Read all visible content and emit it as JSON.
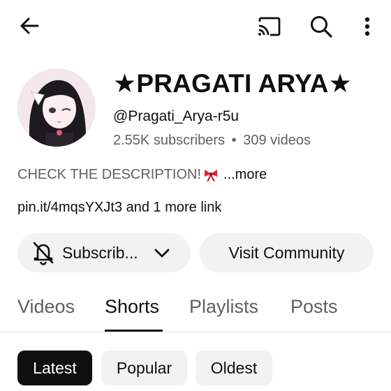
{
  "channel": {
    "name": "★PRAGATI ARYA★",
    "handle": "@Pragati_Arya-r5u",
    "subscribers": "2.55K subscribers",
    "separator": "•",
    "videos": "309 videos",
    "description": "CHECK THE DESCRIPTION!",
    "description_emoji": "ribbon-icon",
    "more": "...more",
    "links": "pin.it/4mqsYXJt3 and 1 more link"
  },
  "actions": {
    "subscribe_label": "Subscrib...",
    "community_label": "Visit Community"
  },
  "tabs": [
    {
      "label": "Videos",
      "active": false
    },
    {
      "label": "Shorts",
      "active": true
    },
    {
      "label": "Playlists",
      "active": false
    },
    {
      "label": "Posts",
      "active": false
    }
  ],
  "filters": [
    {
      "label": "Latest",
      "selected": true
    },
    {
      "label": "Popular",
      "selected": false
    },
    {
      "label": "Oldest",
      "selected": false
    }
  ],
  "icons": {
    "back": "back-arrow-icon",
    "cast": "cast-icon",
    "search": "search-icon",
    "menu": "more-vert-icon",
    "bell": "bell-off-icon",
    "chevron": "chevron-down-icon"
  }
}
